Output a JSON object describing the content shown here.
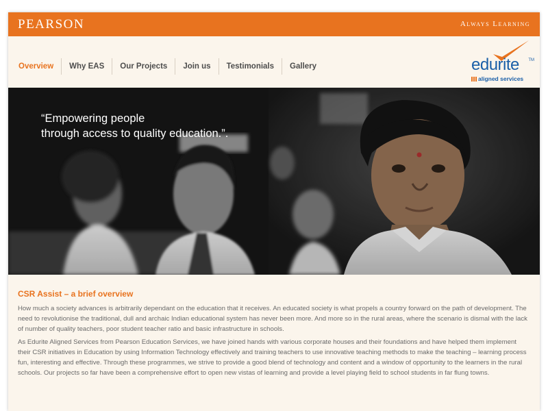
{
  "header": {
    "brand": "PEARSON",
    "tagline": "Always Learning"
  },
  "nav": {
    "items": [
      {
        "label": "Overview",
        "active": true
      },
      {
        "label": "Why EAS"
      },
      {
        "label": "Our Projects"
      },
      {
        "label": "Join us"
      },
      {
        "label": "Testimonials"
      },
      {
        "label": "Gallery"
      }
    ]
  },
  "logo": {
    "word": "edurite",
    "tm": "TM",
    "sub": "aligned services"
  },
  "hero": {
    "quote_line1": "“Empowering people",
    "quote_line2": "through access to quality education.”."
  },
  "main": {
    "title": "CSR Assist – a brief overview",
    "paragraph1": "How much a society advances is arbitrarily dependant on the education that it receives. An educated society is what propels a country forward on the path of development. The need to revolutionise the traditional, dull and archaic Indian educational system has never been more. And more so in the rural areas, where the scenario is dismal with the lack of number of quality teachers, poor student teacher ratio and basic infrastructure in schools.",
    "paragraph2": "As Edurite Aligned Services from Pearson Education Services, we have joined hands with various corporate houses and their foundations and have helped them implement their CSR initiatives in Education by using Information Technology effectively and training teachers to use innovative teaching methods to make the teaching – learning process fun, interesting and effective. Through these programmes, we strive to provide a good blend of technology and content and a window of opportunity to the learners in the rural schools. Our projects so far have been a comprehensive effort to open new vistas of learning and provide a level playing field to school students in far flung towns."
  },
  "colors": {
    "accent": "#e8731f",
    "logo_blue": "#1a5fa8",
    "page_bg": "#fbf5ec",
    "text": "#6a6a6a"
  },
  "icons": [
    "checkmark-icon",
    "grid-icon"
  ]
}
